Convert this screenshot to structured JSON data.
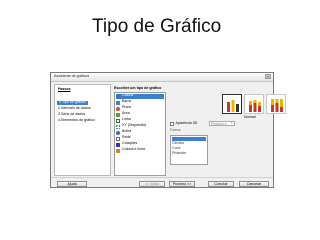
{
  "slide": {
    "title": "Tipo de Gráfico"
  },
  "dialog": {
    "title": "Assistente de gráficos",
    "close": "×",
    "steps_header": "Passos",
    "steps": [
      "1.Tipo de gráfico",
      "2.Intervalo de dados",
      "3.Série de dados",
      "4.Elementos do gráfico"
    ],
    "type_header": "Escolher um tipo de gráfico",
    "chart_types": [
      {
        "label": "Coluna",
        "icon": "column-chart-icon",
        "color": "#3c6fc0"
      },
      {
        "label": "Barra",
        "icon": "bar-chart-icon",
        "color": "#4a7cc9"
      },
      {
        "label": "Pizza",
        "icon": "pie-chart-icon",
        "color": "#d44a3a"
      },
      {
        "label": "Área",
        "icon": "area-chart-icon",
        "color": "#5c9a3a"
      },
      {
        "label": "Linha",
        "icon": "line-chart-icon",
        "color": "#2f7d3a"
      },
      {
        "label": "XY (Dispersão)",
        "icon": "scatter-chart-icon",
        "color": "#3a8a8a"
      },
      {
        "label": "Bolha",
        "icon": "bubble-chart-icon",
        "color": "#3a6ab8"
      },
      {
        "label": "Rede",
        "icon": "net-chart-icon",
        "color": "#6a6a6a"
      },
      {
        "label": "Cotações",
        "icon": "stock-chart-icon",
        "color": "#3a3a9a"
      },
      {
        "label": "Coluna e linha",
        "icon": "column-line-chart-icon",
        "color": "#c88a2a"
      }
    ],
    "subtype_label": "Normal",
    "appearance_label": "Aparência 3D",
    "appearance_value": "Realístico",
    "shape_label": "Forma",
    "shapes": [
      "",
      "Cilindro",
      "Cone",
      "Pirâmide"
    ],
    "buttons": {
      "help": "Ajuda",
      "back": "<< Voltar",
      "next": "Próximo >>",
      "finish": "Concluir",
      "cancel": "Cancelar"
    },
    "colors": {
      "selection": "#3b7fd1",
      "bar_red": "#c0392b",
      "bar_yellow": "#e8b400",
      "bar_dark": "#333333"
    }
  }
}
